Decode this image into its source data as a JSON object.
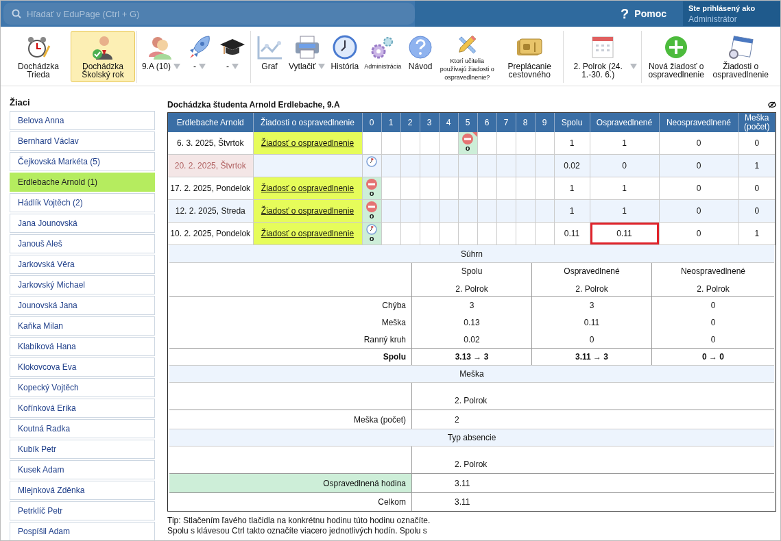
{
  "top_bar": {
    "search": {
      "placeholder": "Hľadať v EduPage (Ctrl + G)"
    },
    "help": {
      "icon": "?",
      "label": "Pomoc"
    },
    "account": {
      "label": "Ste prihlásený ako",
      "name": "Administrátor"
    }
  },
  "toolbar": [
    [
      {
        "label": "Dochádzka Trieda",
        "selected": false,
        "dropdown": false,
        "small": false
      },
      {
        "label": "Dochádzka Školský rok",
        "selected": true,
        "dropdown": false,
        "small": false
      }
    ],
    [
      {
        "label": "9.A (10)",
        "selected": false,
        "dropdown": true,
        "small": false
      },
      {
        "label": "-",
        "selected": false,
        "dropdown": true,
        "small": false
      },
      {
        "label": "-",
        "selected": false,
        "dropdown": true,
        "small": false
      }
    ],
    [
      {
        "label": "Graf",
        "selected": false,
        "dropdown": false,
        "small": false
      },
      {
        "label": "Vytlačiť",
        "selected": false,
        "dropdown": true,
        "small": false
      },
      {
        "label": "História",
        "selected": false,
        "dropdown": false,
        "small": false
      },
      {
        "label": "Administrácia",
        "selected": false,
        "dropdown": false,
        "small": true
      },
      {
        "label": "Návod",
        "selected": false,
        "dropdown": false,
        "small": false
      },
      {
        "label": "Ktorí učitelia používajú žiadosti o ospravedlnenie?",
        "selected": false,
        "dropdown": false,
        "small": true
      },
      {
        "label": "Preplácanie cestovného",
        "selected": false,
        "dropdown": false,
        "small": false
      }
    ],
    [
      {
        "label": "2. Polrok (24. 1.-30. 6.)",
        "selected": false,
        "dropdown": true,
        "small": false
      }
    ],
    [
      {
        "label": "Nová žiadosť o ospravedlnenie",
        "selected": false,
        "dropdown": false,
        "small": false
      },
      {
        "label": "Žiadosti o ospravedlnenie",
        "selected": false,
        "dropdown": false,
        "small": false
      }
    ]
  ],
  "sidebar": {
    "title": "Žiaci",
    "students": [
      {
        "name": "Belova Anna",
        "selected": false
      },
      {
        "name": "Bernhard Václav",
        "selected": false
      },
      {
        "name": "Čejkovská Markéta (5)",
        "selected": false
      },
      {
        "name": "Erdlebache Arnold (1)",
        "selected": true
      },
      {
        "name": "Hádlík Vojtěch (2)",
        "selected": false
      },
      {
        "name": "Jana Jounovská",
        "selected": false
      },
      {
        "name": "Janouš Aleš",
        "selected": false
      },
      {
        "name": "Jarkovská Věra",
        "selected": false
      },
      {
        "name": "Jarkovský Michael",
        "selected": false
      },
      {
        "name": "Jounovská Jana",
        "selected": false
      },
      {
        "name": "Kaňka Milan",
        "selected": false
      },
      {
        "name": "Klabíková Hana",
        "selected": false
      },
      {
        "name": "Klokovcova Eva",
        "selected": false
      },
      {
        "name": "Kopecký Vojtěch",
        "selected": false
      },
      {
        "name": "Kořínková Erika",
        "selected": false
      },
      {
        "name": "Koutná Radka",
        "selected": false
      },
      {
        "name": "Kubík Petr",
        "selected": false
      },
      {
        "name": "Kusek Adam",
        "selected": false
      },
      {
        "name": "Mlejnková Zděnka",
        "selected": false
      },
      {
        "name": "Petrklíč Petr",
        "selected": false
      },
      {
        "name": "Pospíšil Adam",
        "selected": false
      }
    ]
  },
  "main": {
    "title": "Dochádzka študenta Arnold Erdlebache, 9.A",
    "table": {
      "columns": [
        "Erdlebache Arnold",
        "Žiadosti o ospravedlnenie",
        "0",
        "1",
        "2",
        "3",
        "4",
        "5",
        "6",
        "7",
        "8",
        "9",
        "Spolu",
        "Ospravedlnené",
        "Neospravedlnené",
        "Meška (počet)"
      ],
      "rows": [
        {
          "date": "6. 3. 2025, Štvrtok",
          "past": false,
          "request": "Žiadosť o ospravedlnenie",
          "periods": [
            {
              "kind": "none"
            },
            {
              "kind": "none"
            },
            {
              "kind": "none"
            },
            {
              "kind": "none"
            },
            {
              "kind": "none"
            },
            {
              "kind": "absence",
              "note": "o",
              "excused": true,
              "flagged": true
            },
            {
              "kind": "none"
            },
            {
              "kind": "none"
            },
            {
              "kind": "none"
            },
            {
              "kind": "none"
            }
          ],
          "totals": [
            {
              "value": "1",
              "highlighted": false
            },
            {
              "value": "1",
              "highlighted": false
            },
            {
              "value": "0",
              "highlighted": false
            },
            {
              "value": "0",
              "highlighted": false
            }
          ]
        },
        {
          "date": "20. 2. 2025, Štvrtok",
          "past": true,
          "periods": [
            {
              "kind": "late",
              "excused": false,
              "flagged": false
            },
            {
              "kind": "none"
            },
            {
              "kind": "none"
            },
            {
              "kind": "none"
            },
            {
              "kind": "none"
            },
            {
              "kind": "none"
            },
            {
              "kind": "none"
            },
            {
              "kind": "none"
            },
            {
              "kind": "none"
            },
            {
              "kind": "none"
            }
          ],
          "totals": [
            {
              "value": "0.02",
              "highlighted": false
            },
            {
              "value": "0",
              "highlighted": false
            },
            {
              "value": "0",
              "highlighted": false
            },
            {
              "value": "1",
              "highlighted": false
            }
          ]
        },
        {
          "date": "17. 2. 2025, Pondelok",
          "past": false,
          "request": "Žiadosť o ospravedlnenie",
          "periods": [
            {
              "kind": "absence",
              "note": "o",
              "excused": true,
              "flagged": false
            },
            {
              "kind": "none"
            },
            {
              "kind": "none"
            },
            {
              "kind": "none"
            },
            {
              "kind": "none"
            },
            {
              "kind": "none"
            },
            {
              "kind": "none"
            },
            {
              "kind": "none"
            },
            {
              "kind": "none"
            },
            {
              "kind": "none"
            }
          ],
          "totals": [
            {
              "value": "1",
              "highlighted": false
            },
            {
              "value": "1",
              "highlighted": false
            },
            {
              "value": "0",
              "highlighted": false
            },
            {
              "value": "0",
              "highlighted": false
            }
          ]
        },
        {
          "date": "12. 2. 2025, Streda",
          "past": false,
          "request": "Žiadosť o ospravedlnenie",
          "periods": [
            {
              "kind": "absence",
              "note": "o",
              "excused": true,
              "flagged": false
            },
            {
              "kind": "none"
            },
            {
              "kind": "none"
            },
            {
              "kind": "none"
            },
            {
              "kind": "none"
            },
            {
              "kind": "none"
            },
            {
              "kind": "none"
            },
            {
              "kind": "none"
            },
            {
              "kind": "none"
            },
            {
              "kind": "none"
            }
          ],
          "totals": [
            {
              "value": "1",
              "highlighted": false
            },
            {
              "value": "1",
              "highlighted": false
            },
            {
              "value": "0",
              "highlighted": false
            },
            {
              "value": "0",
              "highlighted": false
            }
          ]
        },
        {
          "date": "10. 2. 2025, Pondelok",
          "past": false,
          "request": "Žiadosť o ospravedlnenie",
          "periods": [
            {
              "kind": "late",
              "note": "o",
              "excused": true,
              "flagged": false
            },
            {
              "kind": "none"
            },
            {
              "kind": "none"
            },
            {
              "kind": "none"
            },
            {
              "kind": "none"
            },
            {
              "kind": "none"
            },
            {
              "kind": "none"
            },
            {
              "kind": "none"
            },
            {
              "kind": "none"
            },
            {
              "kind": "none"
            }
          ],
          "totals": [
            {
              "value": "0.11",
              "highlighted": false
            },
            {
              "value": "0.11",
              "highlighted": true
            },
            {
              "value": "0",
              "highlighted": false
            },
            {
              "value": "1",
              "highlighted": false
            }
          ]
        }
      ]
    },
    "summary": {
      "title": "Súhrn",
      "columns": [
        {
          "name": "Spolu",
          "term": "2. Polrok"
        },
        {
          "name": "Ospravedlnené",
          "term": "2. Polrok"
        },
        {
          "name": "Neospravedlnené",
          "term": "2. Polrok"
        }
      ],
      "rows": [
        {
          "label": "Chýba",
          "values": [
            "3",
            "3",
            "0"
          ],
          "bold": false
        },
        {
          "label": "Meška",
          "values": [
            "0.13",
            "0.11",
            "0"
          ],
          "bold": false
        },
        {
          "label": "Ranný kruh",
          "values": [
            "0.02",
            "0",
            "0"
          ],
          "bold": false
        },
        {
          "label": "Spolu",
          "values": [
            "3.13 → 3",
            "3.11 → 3",
            "0 → 0"
          ],
          "bold": true
        }
      ]
    },
    "late": {
      "title": "Meška",
      "term": "2. Polrok",
      "rows": [
        {
          "label": "Meška (počet)",
          "value": "2",
          "highlighted": false
        }
      ]
    },
    "absence_type": {
      "title": "Typ absencie",
      "term": "2. Polrok",
      "rows": [
        {
          "label": "Ospravedlnená hodina",
          "value": "3.11",
          "highlighted": true
        },
        {
          "label": "Celkom",
          "value": "3.11",
          "highlighted": false
        }
      ]
    },
    "tip": [
      "Tip: Stlačením ľavého tlačidla na konkrétnu hodinu túto hodinu označíte.",
      "Spolu s klávesou Ctrl takto označíte viacero jednotlivých hodín. Spolu s"
    ]
  }
}
